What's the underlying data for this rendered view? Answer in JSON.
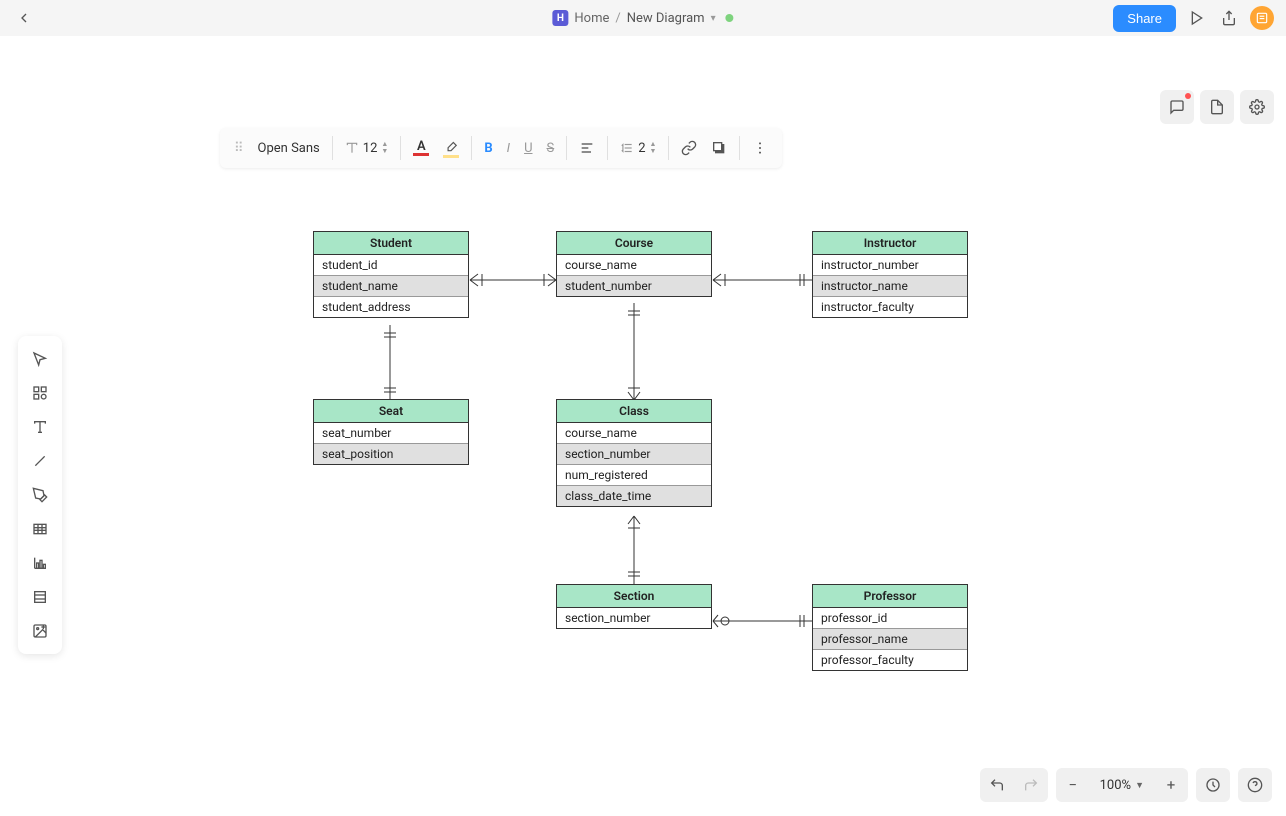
{
  "topbar": {
    "home_label": "Home",
    "doc_label": "New Diagram",
    "share_label": "Share"
  },
  "format_toolbar": {
    "font": "Open Sans",
    "font_size": "12",
    "line_height": "2"
  },
  "zoom": {
    "level": "100%"
  },
  "entities": {
    "student": {
      "title": "Student",
      "rows": [
        "student_id",
        "student_name",
        "student_address"
      ]
    },
    "course": {
      "title": "Course",
      "rows": [
        "course_name",
        "student_number"
      ]
    },
    "instructor": {
      "title": "Instructor",
      "rows": [
        "instructor_number",
        "instructor_name",
        "instructor_faculty"
      ]
    },
    "seat": {
      "title": "Seat",
      "rows": [
        "seat_number",
        "seat_position"
      ]
    },
    "class": {
      "title": "Class",
      "rows": [
        "course_name",
        "section_number",
        "num_registered",
        "class_date_time"
      ]
    },
    "section": {
      "title": "Section",
      "rows": [
        "section_number"
      ]
    },
    "professor": {
      "title": "Professor",
      "rows": [
        "professor_id",
        "professor_name",
        "professor_faculty"
      ]
    }
  },
  "relationships": [
    {
      "from": "Student",
      "to": "Course",
      "type": "many-to-many"
    },
    {
      "from": "Course",
      "to": "Instructor",
      "type": "many-to-many-mandatory"
    },
    {
      "from": "Student",
      "to": "Seat",
      "type": "one-to-one"
    },
    {
      "from": "Course",
      "to": "Class",
      "type": "one-to-many"
    },
    {
      "from": "Class",
      "to": "Section",
      "type": "one-to-one-optional"
    },
    {
      "from": "Section",
      "to": "Professor",
      "type": "many-to-one-optional"
    }
  ],
  "colors": {
    "entity_header": "#a8e6c7",
    "primary": "#2b8cff"
  }
}
